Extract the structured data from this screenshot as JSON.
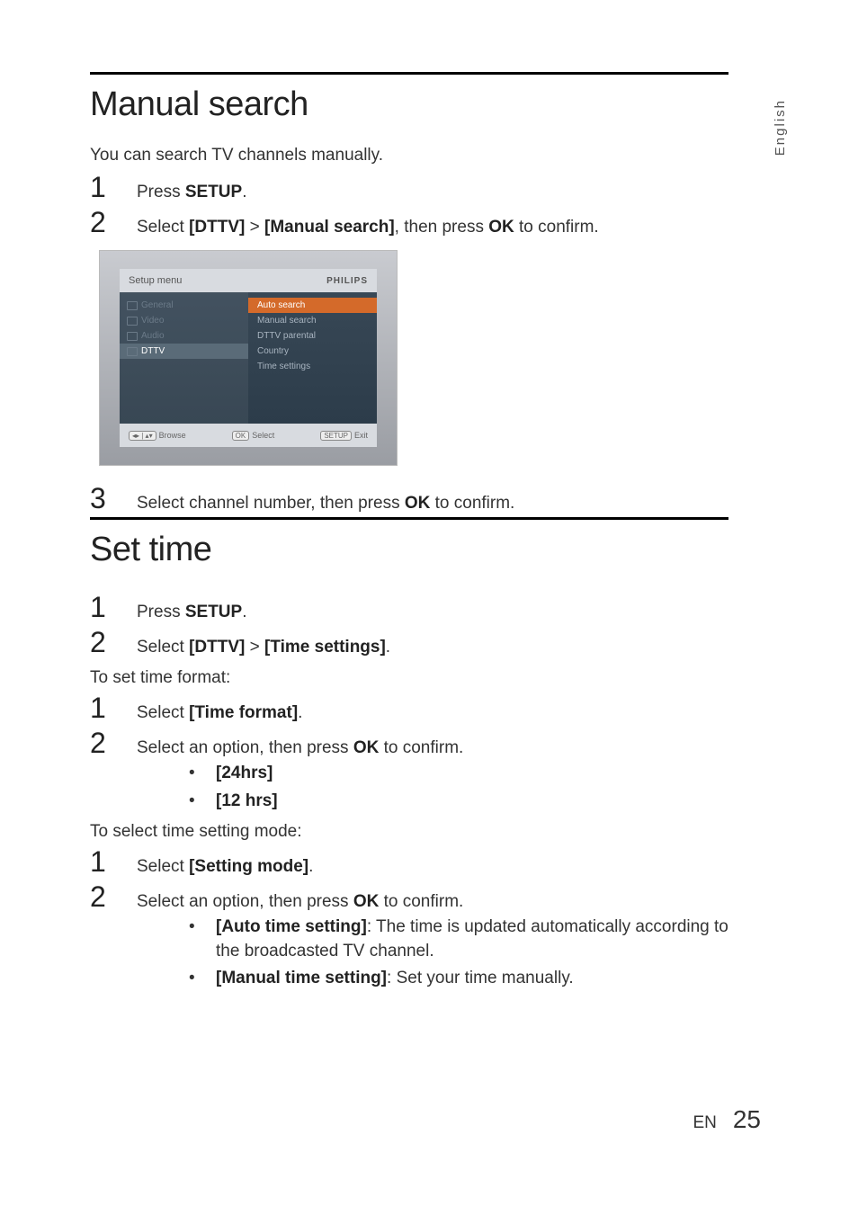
{
  "sidebar": {
    "lang": "English"
  },
  "sections": {
    "manualSearch": {
      "title": "Manual search",
      "intro": "You can search TV channels manually.",
      "steps": [
        {
          "pre": "Press ",
          "b1": "SETUP",
          "post": "."
        },
        {
          "pre": "Select ",
          "b1": "[DTTV]",
          "mid": " > ",
          "b2": "[Manual search]",
          "mid2": ", then press ",
          "b3": "OK",
          "post": " to confirm."
        }
      ],
      "step3": {
        "pre": "Select channel number, then press ",
        "b1": "OK",
        "post": " to confirm."
      }
    },
    "setTime": {
      "title": "Set time",
      "steps1": [
        {
          "pre": "Press ",
          "b1": "SETUP",
          "post": "."
        },
        {
          "pre": "Select ",
          "b1": "[DTTV]",
          "mid": " > ",
          "b2": "[Time settings]",
          "post": "."
        }
      ],
      "sub1": "To set time format:",
      "steps2": [
        {
          "pre": "Select ",
          "b1": "[Time format]",
          "post": "."
        },
        {
          "pre": "Select an option, then press ",
          "b1": "OK",
          "post": " to confirm."
        }
      ],
      "bullets1": [
        {
          "b": "[24hrs]"
        },
        {
          "b": "[12 hrs]"
        }
      ],
      "sub2": "To select time setting mode:",
      "steps3": [
        {
          "pre": "Select ",
          "b1": "[Setting mode]",
          "post": "."
        },
        {
          "pre": "Select an option, then press ",
          "b1": "OK",
          "post": " to confirm."
        }
      ],
      "bullets2": [
        {
          "b": "[Auto time setting]",
          "post": ": The time is updated automatically according to the broadcasted TV channel."
        },
        {
          "b": "[Manual time setting]",
          "post": ": Set your time manually."
        }
      ]
    }
  },
  "menuShot": {
    "header": "Setup menu",
    "brand": "PHILIPS",
    "left": [
      "General",
      "Video",
      "Audio",
      "DTTV"
    ],
    "leftActiveIndex": 3,
    "right": [
      "Auto search",
      "Manual search",
      "DTTV parental",
      "Country",
      "Time settings"
    ],
    "rightHlIndex": 0,
    "footer": {
      "browseKey": "◂▸ | ▴▾",
      "browse": "Browse",
      "selectKey": "OK",
      "select": "Select",
      "exitKey": "SETUP",
      "exit": "Exit"
    }
  },
  "footer": {
    "lang": "EN",
    "page": "25"
  }
}
